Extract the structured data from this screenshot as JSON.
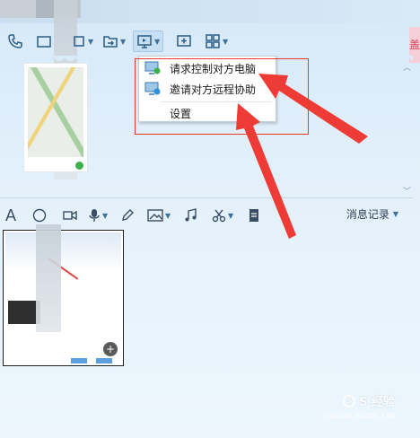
{
  "toolbar": {
    "icons": [
      "phone-icon",
      "window-icon",
      "video-icon",
      "transfer-file-icon",
      "remote-desktop-icon",
      "add-icon",
      "apps-icon"
    ]
  },
  "remote_menu": {
    "items": [
      {
        "label": "请求控制对方电脑",
        "icon": "request-control-icon"
      },
      {
        "label": "邀请对方远程协助",
        "icon": "invite-assist-icon"
      },
      {
        "label": "设置",
        "icon": ""
      }
    ]
  },
  "editbar": {
    "icons": [
      "font-icon",
      "emoji-icon",
      "video-call-icon",
      "mic-icon",
      "pen-icon",
      "image-icon",
      "music-icon",
      "scissors-icon",
      "doc-icon"
    ],
    "history_label": "消息记录"
  },
  "pink_corner_text": "盖",
  "watermark": {
    "brand": "S 经验",
    "logo_letter": "S",
    "sub": "JINGYAN.BAIDU.COM"
  },
  "colors": {
    "accent": "#2b5d86",
    "annotation_red": "#e53935",
    "background": "#e4f1fb"
  }
}
